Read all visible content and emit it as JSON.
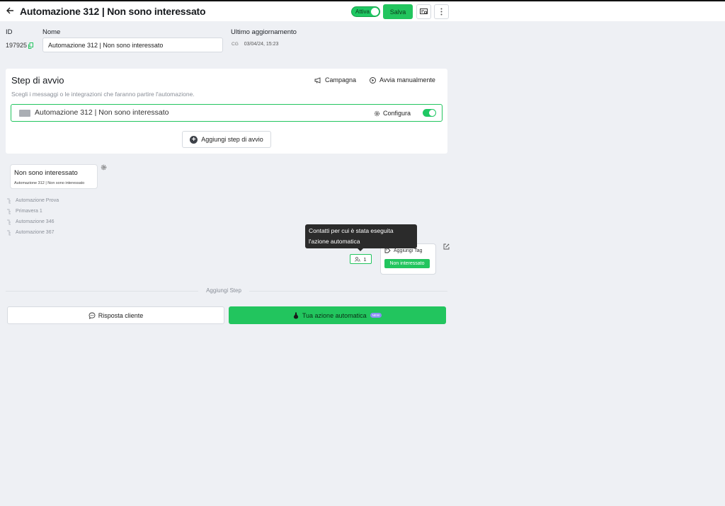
{
  "header": {
    "title": "Automazione 312 | Non sono interessato",
    "status_label": "Attiva",
    "save_label": "Salva"
  },
  "meta": {
    "id_label": "ID",
    "id_value": "197925",
    "name_label": "Nome",
    "name_value": "Automazione 312 | Non sono interessato",
    "updated_label": "Ultimo aggiornamento",
    "updated_by": "CG",
    "updated_at": "03/04/24, 15:23"
  },
  "start_card": {
    "title": "Step di avvio",
    "subtitle": "Scegli i messaggi o le integrazioni che faranno partire l'automazione.",
    "campaign_label": "Campagna",
    "manual_label": "Avvia manualmente",
    "trigger_name": "Automazione 312 | Non sono interessato",
    "configure_label": "Configura",
    "add_trigger_label": "Aggiungi step di avvio"
  },
  "flow": {
    "start_node_title": "Non sono interessato",
    "start_node_sub": "Automazione 312 | Non sono interessato",
    "automations": [
      "Automazione Prova",
      "Primavera 1",
      "Automazione 346",
      "Automazione 367"
    ],
    "tooltip_line1": "Contatti per cui è stata eseguita",
    "tooltip_line2": "l'azione automatica",
    "counter_value": "1",
    "tag_node_title": "Aggiungi Tag",
    "tag_value": "Non interessato"
  },
  "footer": {
    "add_step_label": "Aggiungi Step",
    "reply_label": "Risposta cliente",
    "action_label": "Tua azione automatica",
    "new_badge": "NEW"
  },
  "colors": {
    "accent": "#22c55e",
    "background": "#eef0f4"
  }
}
